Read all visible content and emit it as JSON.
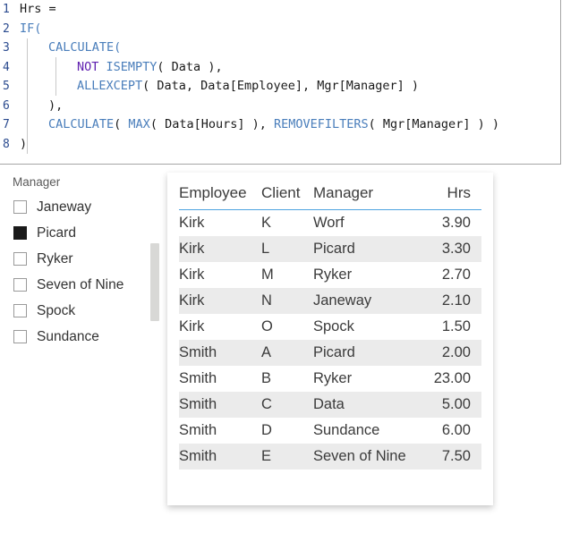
{
  "code_editor": {
    "name": "dax-formula-editor",
    "lines": [
      {
        "number": "1",
        "indent": 0,
        "tokens": [
          {
            "t": "Hrs =",
            "c": "plain"
          }
        ]
      },
      {
        "number": "2",
        "indent": 0,
        "tokens": [
          {
            "t": "IF(",
            "c": "fn"
          }
        ]
      },
      {
        "number": "3",
        "indent": 1,
        "tokens": [
          {
            "t": "CALCULATE(",
            "c": "fn"
          }
        ]
      },
      {
        "number": "4",
        "indent": 2,
        "tokens": [
          {
            "t": "NOT ",
            "c": "kw"
          },
          {
            "t": "ISEMPTY",
            "c": "fn"
          },
          {
            "t": "( Data ),",
            "c": "plain"
          }
        ]
      },
      {
        "number": "5",
        "indent": 2,
        "tokens": [
          {
            "t": "ALLEXCEPT",
            "c": "fn"
          },
          {
            "t": "( Data, Data[Employee], Mgr[Manager] )",
            "c": "plain"
          }
        ]
      },
      {
        "number": "6",
        "indent": 1,
        "tokens": [
          {
            "t": "),",
            "c": "plain"
          }
        ]
      },
      {
        "number": "7",
        "indent": 1,
        "tokens": [
          {
            "t": "CALCULATE",
            "c": "fn"
          },
          {
            "t": "( ",
            "c": "plain"
          },
          {
            "t": "MAX",
            "c": "fn"
          },
          {
            "t": "( Data[Hours] ), ",
            "c": "plain"
          },
          {
            "t": "REMOVEFILTERS",
            "c": "fn"
          },
          {
            "t": "( Mgr[Manager] ) )",
            "c": "plain"
          }
        ]
      },
      {
        "number": "8",
        "indent": 0,
        "tokens": [
          {
            "t": ")",
            "c": "plain"
          }
        ]
      }
    ],
    "colors": {
      "function": "#4a7ebb",
      "keyword": "#6020b0",
      "plain": "#1a1a1a",
      "line_number": "#2b4b8f"
    }
  },
  "slicer": {
    "title": "Manager",
    "items": [
      {
        "label": "Janeway",
        "checked": false
      },
      {
        "label": "Picard",
        "checked": true
      },
      {
        "label": "Ryker",
        "checked": false
      },
      {
        "label": "Seven of Nine",
        "checked": false
      },
      {
        "label": "Spock",
        "checked": false
      },
      {
        "label": "Sundance",
        "checked": false
      }
    ],
    "scrollbar_color": "#d8d8d6"
  },
  "table": {
    "name": "employee-hours-table",
    "accent_color": "#4ea3e0",
    "alt_row_color": "#ebebeb",
    "columns": [
      {
        "key": "employee",
        "label": "Employee",
        "align": "left"
      },
      {
        "key": "client",
        "label": "Client",
        "align": "left"
      },
      {
        "key": "manager",
        "label": "Manager",
        "align": "left"
      },
      {
        "key": "hrs",
        "label": "Hrs",
        "align": "right"
      }
    ],
    "rows": [
      {
        "employee": "Kirk",
        "client": "K",
        "manager": "Worf",
        "hrs": "3.90"
      },
      {
        "employee": "Kirk",
        "client": "L",
        "manager": "Picard",
        "hrs": "3.30"
      },
      {
        "employee": "Kirk",
        "client": "M",
        "manager": "Ryker",
        "hrs": "2.70"
      },
      {
        "employee": "Kirk",
        "client": "N",
        "manager": "Janeway",
        "hrs": "2.10"
      },
      {
        "employee": "Kirk",
        "client": "O",
        "manager": "Spock",
        "hrs": "1.50"
      },
      {
        "employee": "Smith",
        "client": "A",
        "manager": "Picard",
        "hrs": "2.00"
      },
      {
        "employee": "Smith",
        "client": "B",
        "manager": "Ryker",
        "hrs": "23.00"
      },
      {
        "employee": "Smith",
        "client": "C",
        "manager": "Data",
        "hrs": "5.00"
      },
      {
        "employee": "Smith",
        "client": "D",
        "manager": "Sundance",
        "hrs": "6.00"
      },
      {
        "employee": "Smith",
        "client": "E",
        "manager": "Seven of Nine",
        "hrs": "7.50"
      }
    ]
  }
}
